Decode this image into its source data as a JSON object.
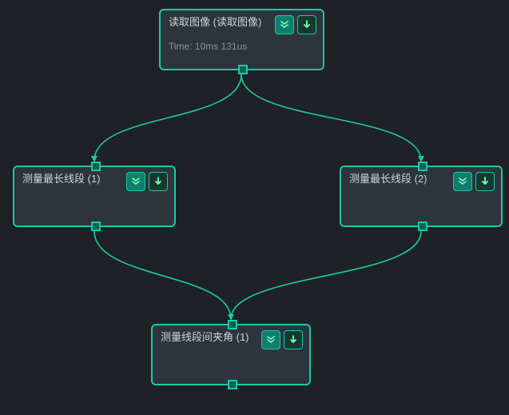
{
  "accent": "#19c9a7",
  "nodes": {
    "read_image": {
      "title": "读取图像 (读取图像)",
      "subtitle": "Time: 10ms 131us",
      "icons": {
        "expand": "chevrons-down-icon",
        "run": "arrow-down-icon"
      }
    },
    "measure_left": {
      "title": "测量最长线段 (1)",
      "icons": {
        "expand": "chevrons-down-icon",
        "run": "arrow-down-icon"
      }
    },
    "measure_right": {
      "title": "测量最长线段 (2)",
      "icons": {
        "expand": "chevrons-down-icon",
        "run": "arrow-down-icon"
      }
    },
    "angle": {
      "title": "测量线段间夹角 (1)",
      "icons": {
        "expand": "chevrons-down-icon",
        "run": "arrow-down-icon"
      }
    }
  },
  "edges": [
    {
      "from": "read_image",
      "to": "measure_left"
    },
    {
      "from": "read_image",
      "to": "measure_right"
    },
    {
      "from": "measure_left",
      "to": "angle"
    },
    {
      "from": "measure_right",
      "to": "angle"
    }
  ]
}
